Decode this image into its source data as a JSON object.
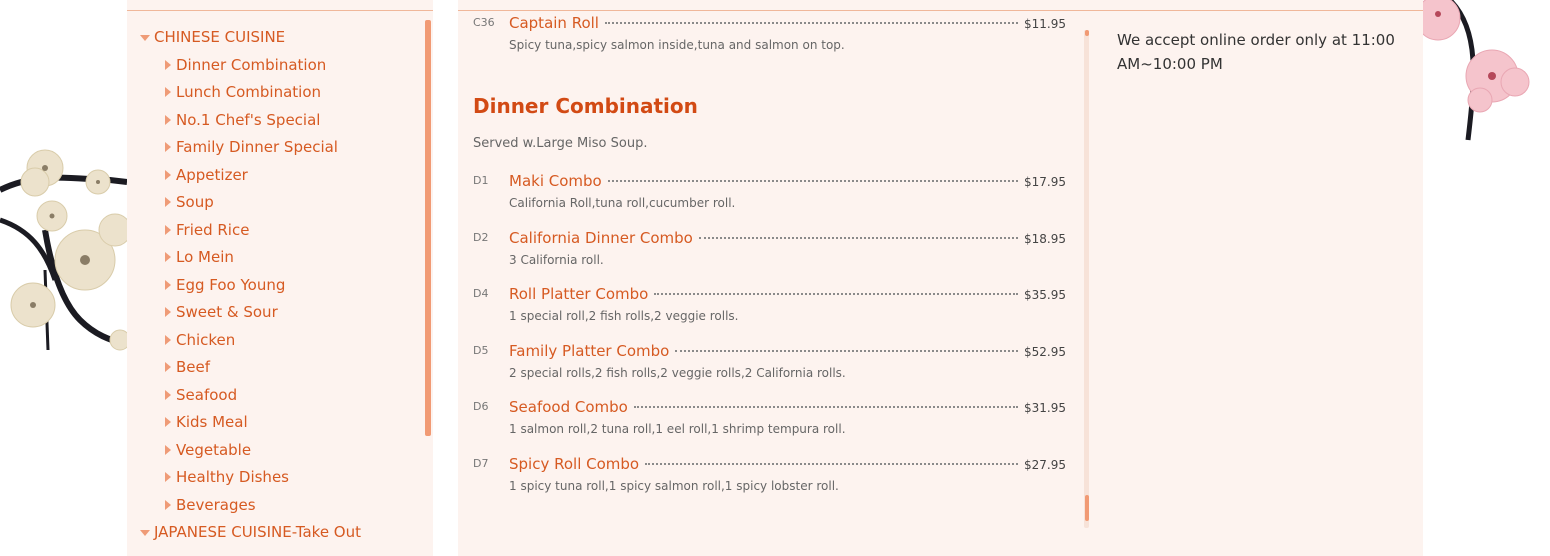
{
  "nav": {
    "categories": [
      {
        "label": "CHINESE CUISINE",
        "items": [
          "Dinner Combination",
          "Lunch Combination",
          "No.1 Chef's Special",
          "Family Dinner Special",
          "Appetizer",
          "Soup",
          "Fried Rice",
          "Lo Mein",
          "Egg Foo Young",
          "Sweet & Sour",
          "Chicken",
          "Beef",
          "Seafood",
          "Kids Meal",
          "Vegetable",
          "Healthy Dishes",
          "Beverages"
        ]
      },
      {
        "label": "JAPANESE CUISINE-Take Out",
        "items": []
      }
    ]
  },
  "menu": {
    "clipped_item": {
      "code": "C36",
      "name": "Captain Roll",
      "price": "$11.95",
      "desc": "Spicy tuna,spicy salmon inside,tuna and salmon on top."
    },
    "category_title": "Dinner Combination",
    "category_desc": "Served w.Large Miso Soup.",
    "items": [
      {
        "code": "D1",
        "name": "Maki Combo",
        "price": "$17.95",
        "desc": "California Roll,tuna roll,cucumber roll."
      },
      {
        "code": "D2",
        "name": "California Dinner Combo",
        "price": "$18.95",
        "desc": "3 California roll."
      },
      {
        "code": "D4",
        "name": "Roll Platter Combo",
        "price": "$35.95",
        "desc": "1 special roll,2 fish rolls,2 veggie rolls."
      },
      {
        "code": "D5",
        "name": "Family Platter Combo",
        "price": "$52.95",
        "desc": "2 special rolls,2 fish rolls,2 veggie rolls,2 California rolls."
      },
      {
        "code": "D6",
        "name": "Seafood Combo",
        "price": "$31.95",
        "desc": "1 salmon roll,2 tuna roll,1 eel roll,1 shrimp tempura roll."
      },
      {
        "code": "D7",
        "name": "Spicy Roll Combo",
        "price": "$27.95",
        "desc": "1 spicy tuna roll,1 spicy salmon roll,1 spicy lobster roll."
      }
    ]
  },
  "notice": {
    "text": "We accept online order only at 11:00 AM~10:00 PM"
  },
  "colors": {
    "accent": "#d65a22",
    "panel": "#fdf3ef",
    "scroll": "#f19a74"
  }
}
